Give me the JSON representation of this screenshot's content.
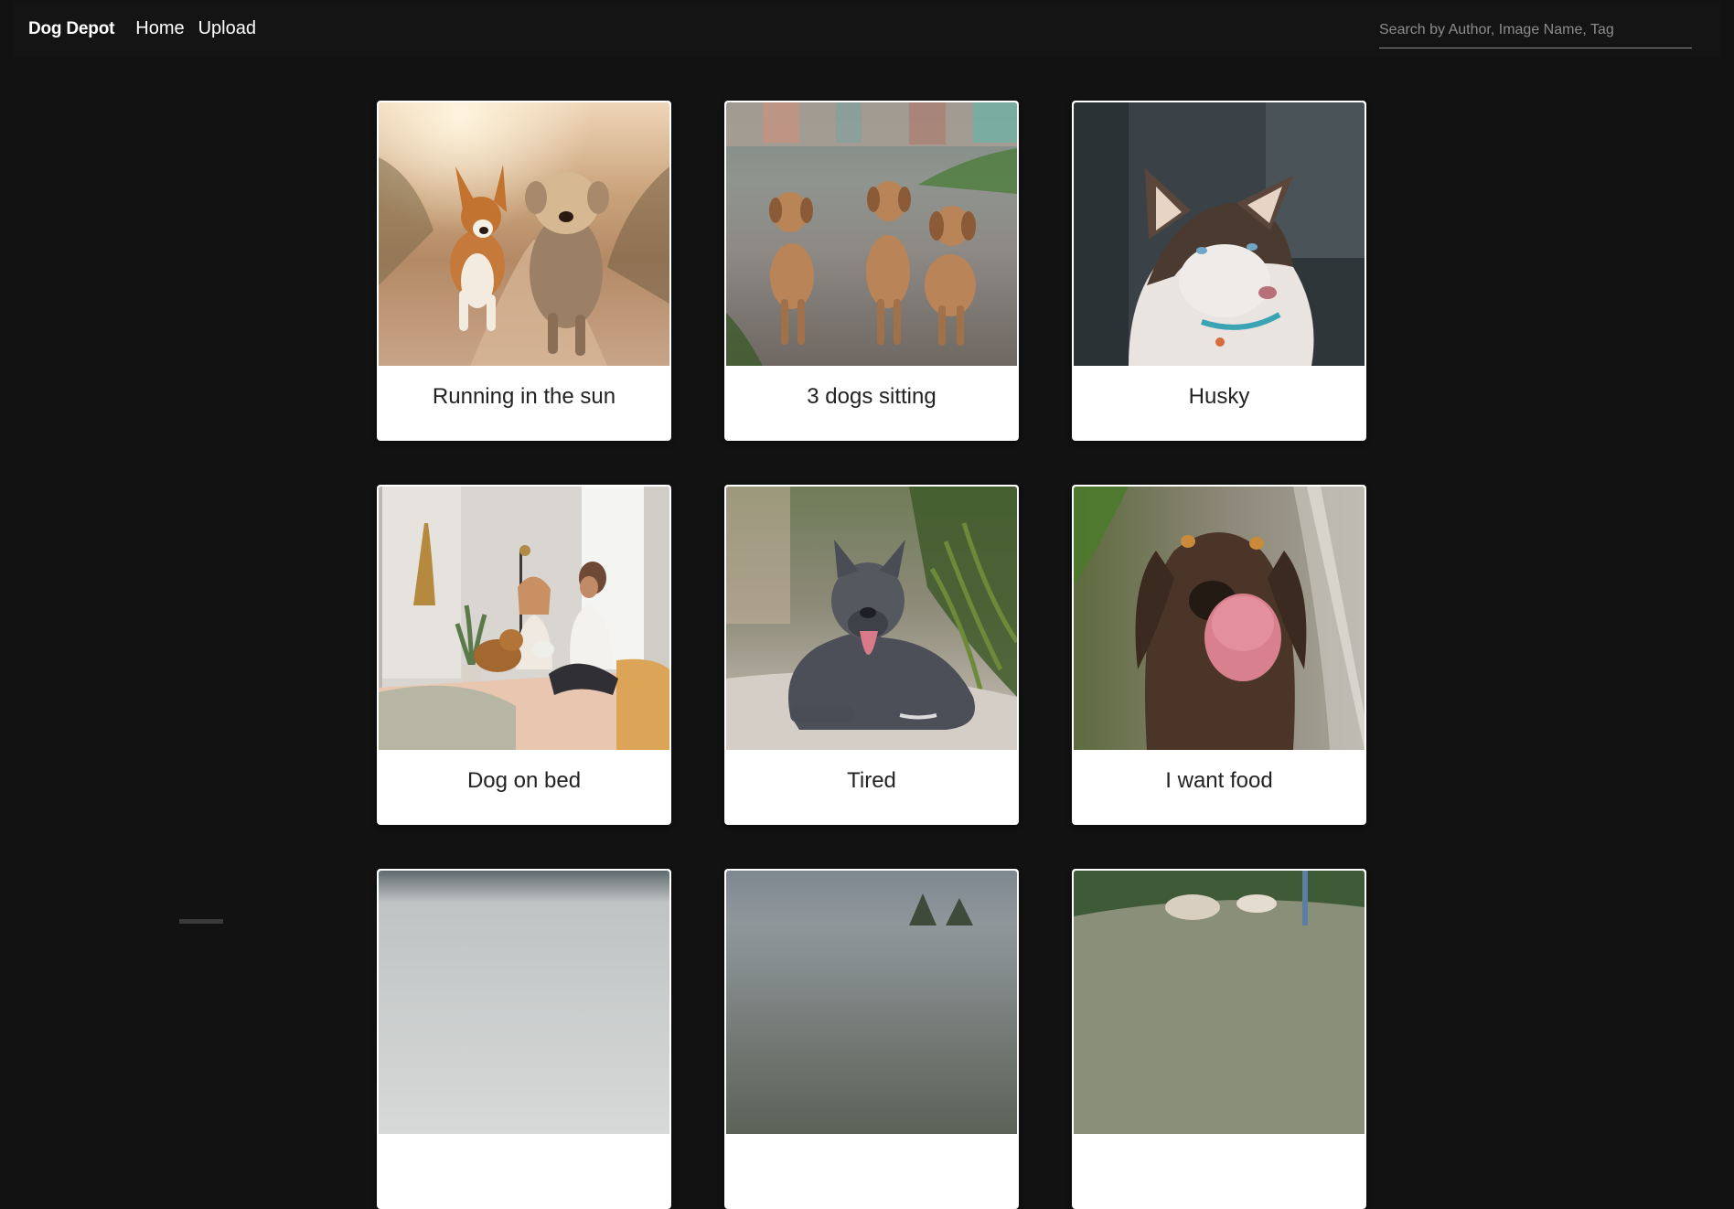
{
  "app": {
    "brand": "Dog Depot",
    "nav": [
      {
        "label": "Home"
      },
      {
        "label": "Upload"
      }
    ],
    "search": {
      "placeholder": "Search by Author, Image Name, Tag",
      "value": ""
    }
  },
  "cards": [
    {
      "title": "Running in the sun",
      "image": "corgi-and-terrier-running-photo"
    },
    {
      "title": "3 dogs sitting",
      "image": "three-puppies-photo"
    },
    {
      "title": "Husky",
      "image": "husky-portrait-photo"
    },
    {
      "title": "Dog on bed",
      "image": "couple-with-dog-on-bed-photo"
    },
    {
      "title": "Tired",
      "image": "pitbull-lying-photo"
    },
    {
      "title": "I want food",
      "image": "labrador-licking-photo"
    },
    {
      "title": "",
      "image": "partial-photo"
    },
    {
      "title": "",
      "image": "partial-photo"
    },
    {
      "title": "",
      "image": "partial-photo"
    }
  ]
}
